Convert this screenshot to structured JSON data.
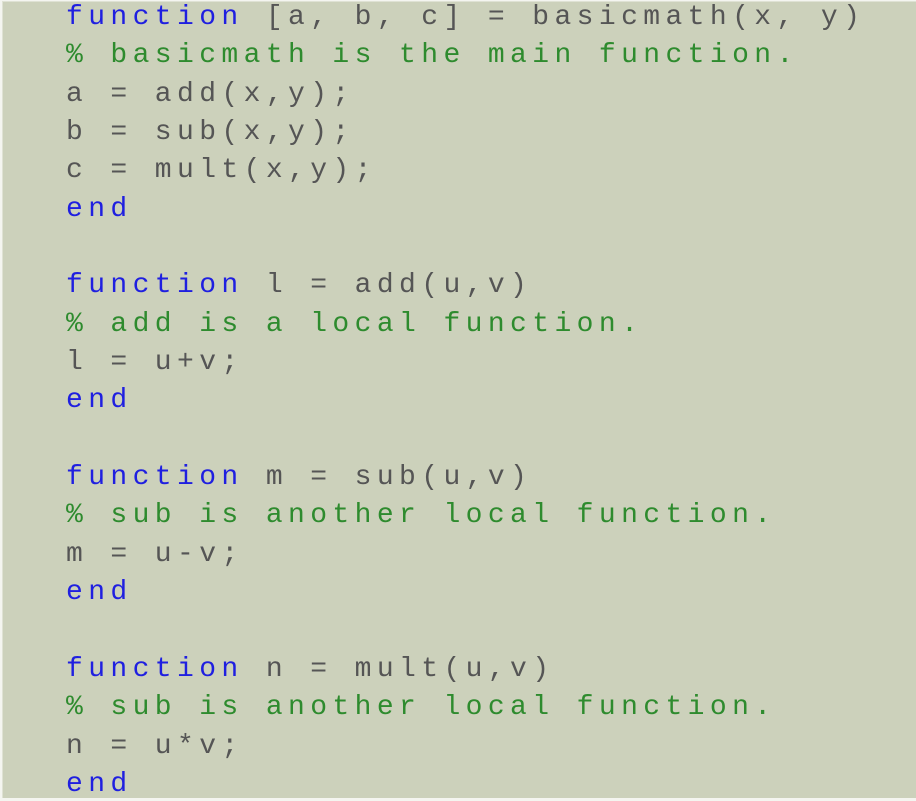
{
  "editor": {
    "background": "#ccd1bb",
    "colors": {
      "keyword": "#1f1fe0",
      "comment": "#2e8b2e",
      "text": "#555555"
    },
    "lines": [
      {
        "kw": "function",
        "text": " [a, b, c] = basicmath(x, y)",
        "comment": ""
      },
      {
        "kw": "",
        "text": "",
        "comment": "% basicmath is the main function."
      },
      {
        "kw": "",
        "text": "a = add(x,y);",
        "comment": ""
      },
      {
        "kw": "",
        "text": "b = sub(x,y);",
        "comment": ""
      },
      {
        "kw": "",
        "text": "c = mult(x,y);",
        "comment": ""
      },
      {
        "kw": "end",
        "text": "",
        "comment": ""
      },
      {
        "kw": "",
        "text": "",
        "comment": ""
      },
      {
        "kw": "function",
        "text": " l = add(u,v)",
        "comment": ""
      },
      {
        "kw": "",
        "text": "",
        "comment": "% add is a local function."
      },
      {
        "kw": "",
        "text": "l = u+v;",
        "comment": ""
      },
      {
        "kw": "end",
        "text": "",
        "comment": ""
      },
      {
        "kw": "",
        "text": "",
        "comment": ""
      },
      {
        "kw": "function",
        "text": " m = sub(u,v)",
        "comment": ""
      },
      {
        "kw": "",
        "text": "",
        "comment": "% sub is another local function."
      },
      {
        "kw": "",
        "text": "m = u-v;",
        "comment": ""
      },
      {
        "kw": "end",
        "text": "",
        "comment": ""
      },
      {
        "kw": "",
        "text": "",
        "comment": ""
      },
      {
        "kw": "function",
        "text": " n = mult(u,v)",
        "comment": ""
      },
      {
        "kw": "",
        "text": "",
        "comment": "% sub is another local function."
      },
      {
        "kw": "",
        "text": "n = u*v;",
        "comment": ""
      },
      {
        "kw": "end",
        "text": "",
        "comment": ""
      }
    ]
  }
}
